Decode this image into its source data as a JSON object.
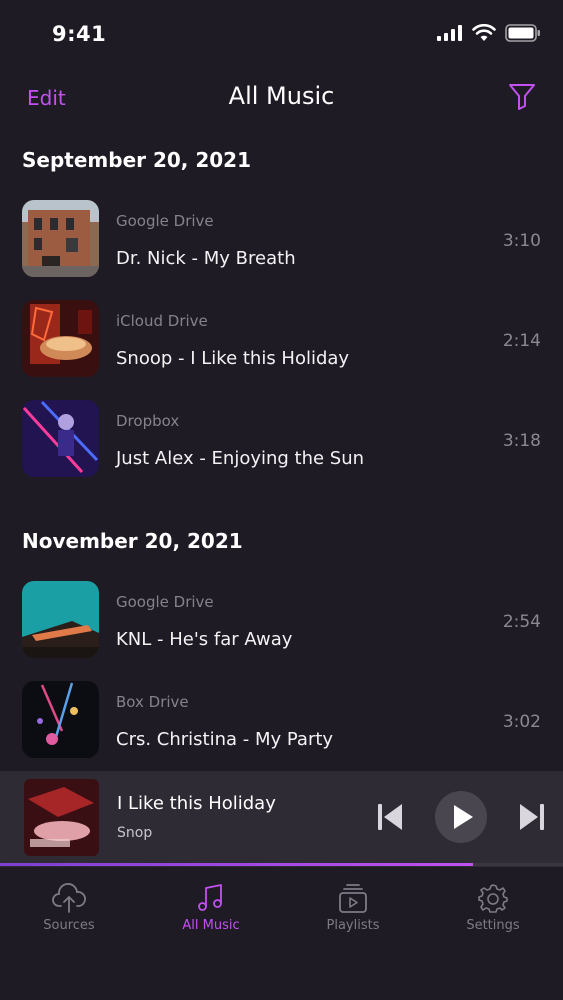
{
  "status_bar": {
    "time": "9:41"
  },
  "nav": {
    "edit_label": "Edit",
    "title": "All Music"
  },
  "sections": [
    {
      "date": "September 20, 2021",
      "tracks": [
        {
          "source": "Google Drive",
          "title": "Dr. Nick - My Breath",
          "duration": "3:10"
        },
        {
          "source": "iCloud Drive",
          "title": "Snoop - I Like this Holiday",
          "duration": "2:14"
        },
        {
          "source": "Dropbox",
          "title": "Just Alex - Enjoying the Sun",
          "duration": "3:18"
        }
      ]
    },
    {
      "date": "November 20, 2021",
      "tracks": [
        {
          "source": "Google Drive",
          "title": "KNL - He's far Away",
          "duration": "2:54"
        },
        {
          "source": "Box Drive",
          "title": "Crs. Christina - My Party",
          "duration": "3:02"
        }
      ]
    }
  ],
  "now_playing": {
    "title": "I Like this Holiday",
    "artist": "Snop",
    "progress": 0.84
  },
  "tabs": [
    {
      "label": "Sources",
      "icon": "cloud-upload-icon",
      "active": false
    },
    {
      "label": "All Music",
      "icon": "music-note-icon",
      "active": true
    },
    {
      "label": "Playlists",
      "icon": "playlist-icon",
      "active": false
    },
    {
      "label": "Settings",
      "icon": "gear-icon",
      "active": false
    }
  ],
  "colors": {
    "accent": "#c151f0",
    "background": "#1f1b24",
    "player": "#2f2b34"
  }
}
